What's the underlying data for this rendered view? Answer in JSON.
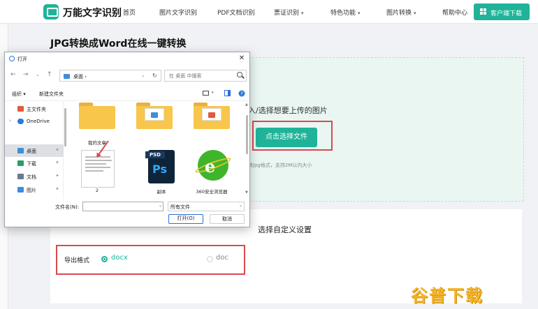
{
  "nav": {
    "brand": "万能文字识别",
    "items": [
      {
        "label": "首页",
        "caret": false
      },
      {
        "label": "图片文字识别",
        "caret": false
      },
      {
        "label": "PDF文档识别",
        "caret": false
      },
      {
        "label": "票证识别",
        "caret": true
      },
      {
        "label": "特色功能",
        "caret": true
      },
      {
        "label": "图片转换",
        "caret": true
      },
      {
        "label": "帮助中心",
        "caret": false
      }
    ],
    "download_button": "客户端下载"
  },
  "page": {
    "title": "JPG转换成Word在线一键转换",
    "upload_hint": "入/选择想要上传的图片",
    "upload_button": "点击选择文件",
    "upload_note": "持jpg格式，支持2M以内大小",
    "settings_label": "选择自定义设置",
    "format_label": "导出格式",
    "format_options": [
      {
        "label": "docx",
        "selected": true
      },
      {
        "label": "doc",
        "selected": false
      }
    ],
    "watermark": "谷普下载"
  },
  "dialog": {
    "title": "打开",
    "close": "✕",
    "breadcrumb": "桌面",
    "search_placeholder": "在 桌面 中搜索",
    "toolbar": {
      "organize": "组织 ▾",
      "new_folder": "新建文件夹"
    },
    "sidebar": [
      {
        "label": "主文件夹",
        "icon": "home-icon",
        "color": "#e05a3c",
        "chevron": "",
        "selected": false,
        "pinned": false
      },
      {
        "label": "OneDrive",
        "icon": "cloud-icon",
        "color": "#2a7ad8",
        "chevron": "›",
        "selected": false,
        "pinned": false
      },
      {
        "label": "桌面",
        "icon": "desktop-icon",
        "color": "#3f8fd8",
        "chevron": "",
        "selected": true,
        "pinned": true
      },
      {
        "label": "下载",
        "icon": "download-icon",
        "color": "#2a9d6a",
        "chevron": "",
        "selected": false,
        "pinned": true
      },
      {
        "label": "文档",
        "icon": "document-icon",
        "color": "#6b7a8f",
        "chevron": "",
        "selected": false,
        "pinned": true
      },
      {
        "label": "图片",
        "icon": "picture-icon",
        "color": "#3a8ee0",
        "chevron": "",
        "selected": false,
        "pinned": true
      }
    ],
    "files": [
      {
        "name": "我的文章",
        "kind": "folder"
      },
      {
        "name": "",
        "kind": "folder-blue"
      },
      {
        "name": "",
        "kind": "folder-red"
      },
      {
        "name": "2",
        "kind": "image"
      },
      {
        "name": "副本",
        "kind": "psd"
      },
      {
        "name": "360安全浏览器",
        "kind": "browser"
      }
    ],
    "filename_label": "文件名(N):",
    "filetype": "所有文件",
    "open_button": "打开(O)",
    "cancel_button": "取消"
  },
  "colors": {
    "accent": "#1fb39a",
    "highlight": "#d9494f",
    "watermark": "#f4b328"
  }
}
